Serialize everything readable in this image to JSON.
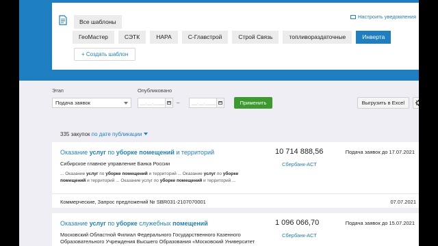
{
  "templates": {
    "all_label": "Все шаблоны",
    "notify_label": "Настроить уведомления",
    "tags": [
      "ГеоМастер",
      "СЭТК",
      "НАРА",
      "С-Главстрой",
      "Строй Связь",
      "топливораздаточные",
      "Инверта"
    ],
    "active_tag": "Инверта",
    "create_label": "+ Создать шаблон"
  },
  "filters": {
    "stage_label": "Этап",
    "stage_value": "Подача заявок",
    "published_label": "Опубликовано",
    "date_from_placeholder": "__.__.____",
    "date_to_placeholder": "__.__.____",
    "date_separator": "–",
    "apply_label": "Применить",
    "export_label": "Выгрузить в Excel"
  },
  "results": {
    "count": "335 закупок",
    "sort_label": "по дате публикации"
  },
  "cards": [
    {
      "title_parts": [
        {
          "t": "Оказание ",
          "b": false
        },
        {
          "t": "услуг",
          "b": true
        },
        {
          "t": " по ",
          "b": false
        },
        {
          "t": "уборке помещений",
          "b": true
        },
        {
          "t": " и территорий",
          "b": false
        }
      ],
      "price": "10 714 888,56",
      "deadline": "Подача заявок до 17.07.2021",
      "platform": "Сбербанк-АСТ",
      "org": "Сибирское главное управление Банка России",
      "snippet_parts": [
        {
          "t": "... Оказание ",
          "b": false
        },
        {
          "t": "услуг",
          "b": true
        },
        {
          "t": " по ",
          "b": false
        },
        {
          "t": "уборке помещений",
          "b": true
        },
        {
          "t": " и территорий ... Оказание ",
          "b": false
        },
        {
          "t": "услуг",
          "b": true
        },
        {
          "t": " по ",
          "b": false
        },
        {
          "t": "уборке помещений",
          "b": true
        },
        {
          "t": " и территорий ... Оказание услуг по ",
          "b": false
        },
        {
          "t": "уборке помещений",
          "b": true
        },
        {
          "t": " и территорий ...",
          "b": false
        }
      ],
      "footer": "Коммерческие, Запрос предложений № SBR031-2107070001",
      "date": "07.07.2021"
    },
    {
      "title_parts": [
        {
          "t": "Оказание ",
          "b": false
        },
        {
          "t": "услуг",
          "b": true
        },
        {
          "t": " по ",
          "b": false
        },
        {
          "t": "уборке",
          "b": true
        },
        {
          "t": " служебных ",
          "b": false
        },
        {
          "t": "помещений",
          "b": true
        }
      ],
      "price": "1 096 066,70",
      "deadline": "Подача заявок до 15.07.2021",
      "platform": "Сбербанк-АСТ",
      "org": "Московский Областной Филиал Федерального Государственного Казенного Образовательного Учреждения Высшего Образования «Московский Университет Министерства Внутренних Дел РФ Имени В.Я. Кикотя»"
    }
  ],
  "colors": {
    "accent": "#1d7ec1",
    "apply": "#3d9a2e",
    "background": "#efeef5"
  }
}
